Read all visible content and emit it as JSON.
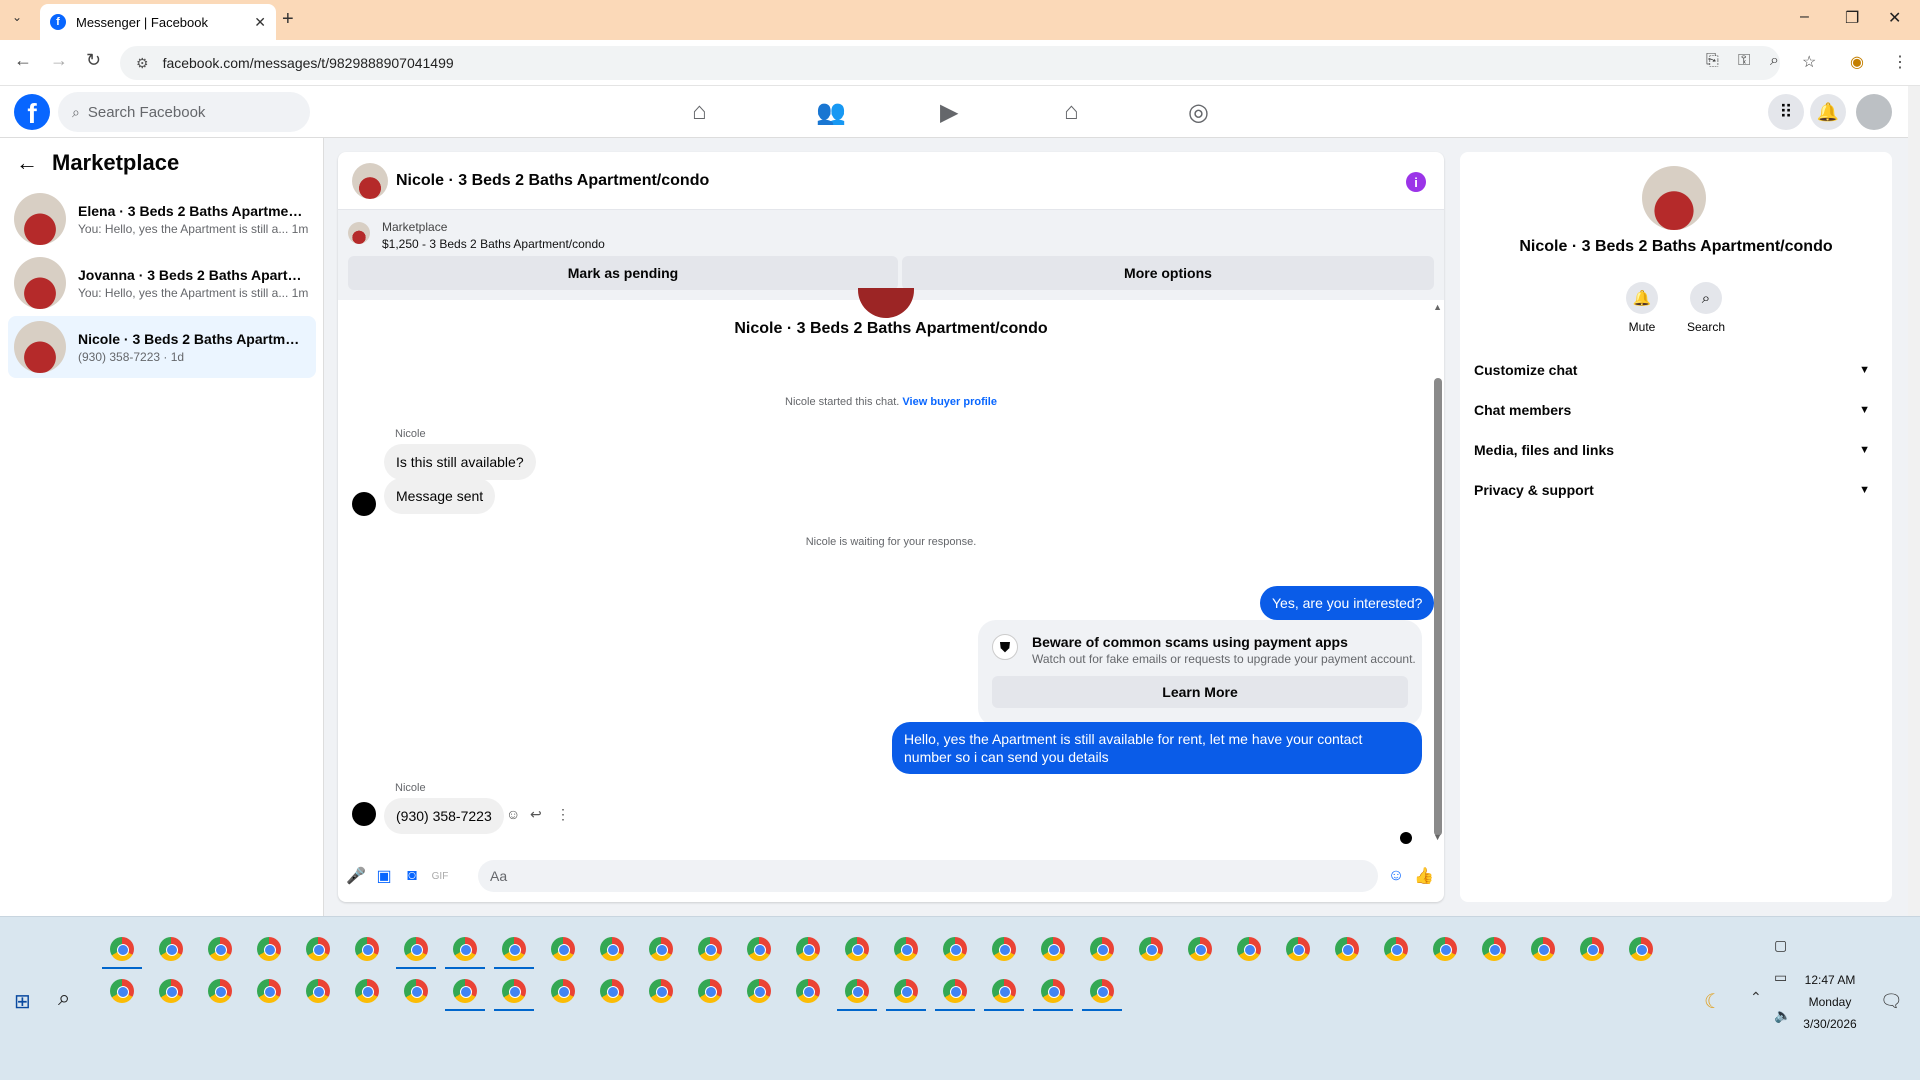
{
  "browser": {
    "tab_title": "Messenger | Facebook",
    "url": "facebook.com/messages/t/9829888907041499"
  },
  "fb": {
    "logo": "f",
    "search_placeholder": "Search Facebook"
  },
  "sidebar": {
    "title": "Marketplace",
    "conversations": [
      {
        "name": "Elena · 3 Beds 2 Baths Apartment/...",
        "preview": "You: Hello, yes the Apartment is still a... 1m"
      },
      {
        "name": "Jovanna · 3 Beds 2 Baths Apartme...",
        "preview": "You: Hello, yes the Apartment is still a... 1m"
      },
      {
        "name": "Nicole · 3 Beds 2 Baths Apartment...",
        "preview": "(930) 358-7223 · 1d"
      }
    ]
  },
  "chat": {
    "header_name": "Nicole · 3 Beds 2 Baths Apartment/condo",
    "marketplace_label": "Marketplace",
    "listing": "$1,250 - 3 Beds 2 Baths Apartment/condo",
    "mark_pending": "Mark as pending",
    "more_options": "More options",
    "top_name": "Nicole · 3 Beds 2 Baths Apartment/condo",
    "started_text": "Nicole started this chat.",
    "view_buyer": "View buyer profile",
    "sender1": "Nicole",
    "msg_in_1": "Is this still available?",
    "msg_in_2": "Message sent",
    "waiting": "Nicole is waiting for your response.",
    "msg_out_1": "Yes, are you interested?",
    "scam_title": "Beware of common scams using payment apps",
    "scam_text": "Watch out for fake emails or requests to upgrade your payment account.",
    "learn_more": "Learn More",
    "msg_out_2": "Hello, yes the Apartment is still available for rent, let me have your contact number so i can send you details",
    "sender2": "Nicole",
    "msg_in_3": "(930) 358-7223",
    "input_placeholder": "Aa"
  },
  "details": {
    "name": "Nicole · 3 Beds 2 Baths Apartment/condo",
    "mute": "Mute",
    "search": "Search",
    "sections": [
      "Customize chat",
      "Chat members",
      "Media, files and links",
      "Privacy & support"
    ]
  },
  "taskbar": {
    "time": "12:47 AM",
    "day": "Monday",
    "date": "3/30/2026"
  },
  "colors": {
    "accent": "#0866ff",
    "outgoing_bubble": "#0a5ce8",
    "tab_bar": "#fbd9b8",
    "info_icon": "#9b34e8"
  }
}
